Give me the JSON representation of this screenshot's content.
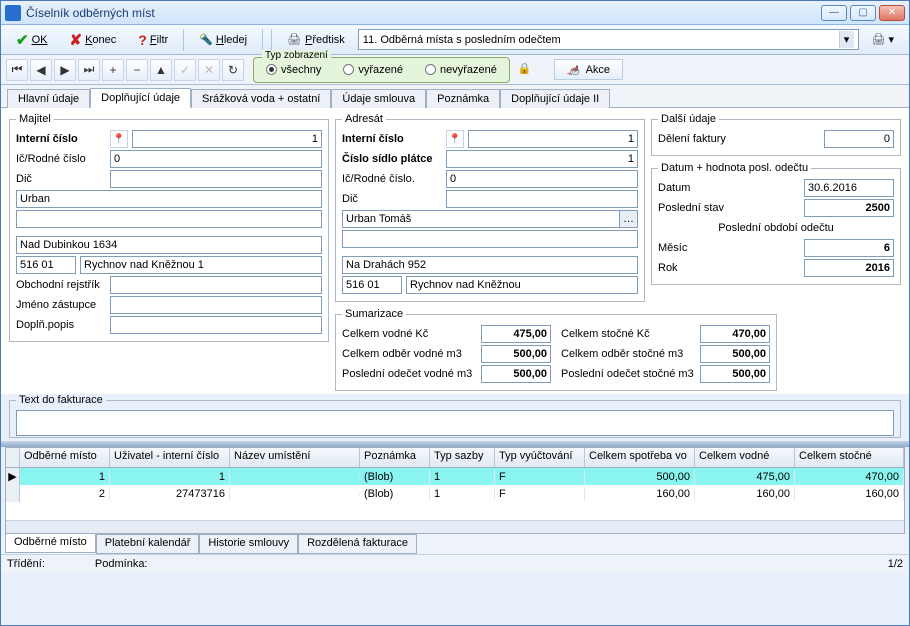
{
  "window": {
    "title": "Číselník odběrných míst"
  },
  "toolbar": {
    "ok": "OK",
    "konec": "Konec",
    "filtr": "Filtr",
    "hledej": "Hledej",
    "predtisk": "Předtisk",
    "predtisk_sel": "11. Odběrná místa s posledním odečtem"
  },
  "viewgroup": {
    "legend": "Typ zobrazení",
    "all": "všechny",
    "vyr": "vyřazené",
    "nev": "nevyřazené"
  },
  "akce": "Akce",
  "tabs": [
    "Hlavní údaje",
    "Doplňující údaje",
    "Srážková voda + ostatní",
    "Údaje smlouva",
    "Poznámka",
    "Doplňující údaje II"
  ],
  "majitel": {
    "legend": "Majitel",
    "interni": "Interní číslo",
    "interni_v": "1",
    "icrodne": "Ič/Rodné číslo",
    "icrodne_v": "0",
    "dic": "Dič",
    "dic_v": "",
    "name": "Urban",
    "line2": "",
    "street": "Nad Dubinkou 1634",
    "zip": "516 01",
    "city": "Rychnov nad Kněžnou 1",
    "obch": "Obchodní rejstřík",
    "obch_v": "",
    "jz": "Jméno zástupce",
    "jz_v": "",
    "dp": "Doplň.popis",
    "dp_v": ""
  },
  "adresat": {
    "legend": "Adresát",
    "interni": "Interní číslo",
    "interni_v": "1",
    "cislosidlo": "Číslo sídlo plátce",
    "cislosidlo_v": "1",
    "icrodne": "Ič/Rodné číslo.",
    "icrodne_v": "0",
    "dic": "Dič",
    "dic_v": "",
    "name": "Urban Tomáš",
    "line2": "",
    "street": "Na Drahách 952",
    "zip": "516 01",
    "city": "Rychnov nad Kněžnou"
  },
  "dalsi": {
    "legend": "Další údaje",
    "del": "Dělení faktury",
    "del_v": "0"
  },
  "datum": {
    "legend": "Datum + hodnota posl. odečtu",
    "datum": "Datum",
    "datum_v": "30.6.2016",
    "posstav": "Poslední stav",
    "posstav_v": "2500",
    "posobdobi": "Poslední období odečtu",
    "mesic": "Měsíc",
    "mesic_v": "6",
    "rok": "Rok",
    "rok_v": "2016"
  },
  "sum": {
    "legend": "Sumarizace",
    "cvkc": "Celkem vodné Kč",
    "cvkc_v": "475,00",
    "cskc": "Celkem stočné Kč",
    "cskc_v": "470,00",
    "cvm3": "Celkem odběr vodné m3",
    "cvm3_v": "500,00",
    "csm3": "Celkem odběr stočné m3",
    "csm3_v": "500,00",
    "povm3": "Poslední odečet vodné m3",
    "povm3_v": "500,00",
    "posm3": "Poslední odečet stočné m3",
    "posm3_v": "500,00"
  },
  "textdo": "Text do fakturace",
  "grid": {
    "headers": [
      "Odběrné místo",
      "Uživatel - interní číslo",
      "Název umístění",
      "Poznámka",
      "Typ sazby",
      "Typ vyúčtování",
      "Celkem spotřeba vo",
      "Celkem vodné",
      "Celkem stočné"
    ],
    "rows": [
      {
        "om": "1",
        "uz": "1",
        "nu": "",
        "pz": "(Blob)",
        "ts": "1",
        "tv": "F",
        "sp": "500,00",
        "cv": "475,00",
        "cs": "470,00"
      },
      {
        "om": "2",
        "uz": "27473716",
        "nu": "",
        "pz": "(Blob)",
        "ts": "1",
        "tv": "F",
        "sp": "160,00",
        "cv": "160,00",
        "cs": "160,00"
      }
    ]
  },
  "btabs": [
    "Odběrné místo",
    "Platební kalendář",
    "Historie smlouvy",
    "Rozdělená fakturace"
  ],
  "status": {
    "trideni": "Třídění:",
    "podminka": "Podmínka:",
    "count": "1/2"
  }
}
